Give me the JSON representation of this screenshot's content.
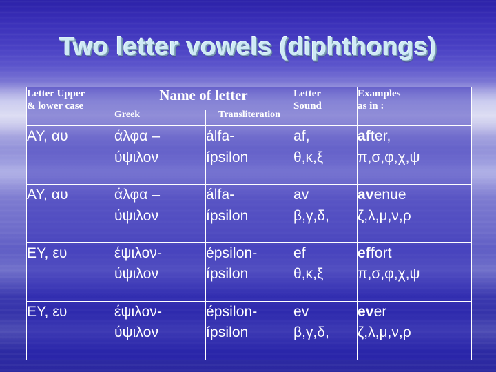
{
  "slide": {
    "title": "Two letter vowels (diphthongs)",
    "title_color": "#cfeaf5",
    "background_color": "#2b21a8",
    "border_color": "#ffffff"
  },
  "table": {
    "headers": {
      "col1_line1": "Letter Upper",
      "col1_line2": "& lower case",
      "name_of_letter": "Name of letter",
      "greek": "Greek",
      "transliteration": "Transliteration",
      "col4_line1": "Letter",
      "col4_line2": "Sound",
      "col5_line1": "Examples",
      "col5_line2": "as in :"
    },
    "rows": [
      {
        "letter_line1": "ΑΥ, αυ",
        "letter_line2": "",
        "greek_line1": "άλφα –",
        "greek_line2": "ύψιλον",
        "translit_line1": "álfa-",
        "translit_line2": "ípsilon",
        "sound_line1": "af,",
        "sound_line2": "θ,κ,ξ",
        "example_bold": "af",
        "example_rest": "ter,",
        "example_line2": "π,σ,φ,χ,ψ"
      },
      {
        "letter_line1": "ΑΥ, αυ",
        "letter_line2": "",
        "greek_line1": "άλφα –",
        "greek_line2": "ύψιλον",
        "translit_line1": "álfa-",
        "translit_line2": "ípsilon",
        "sound_line1": "av",
        "sound_line2": "β,γ,δ,",
        "example_bold": "av",
        "example_rest": "enue",
        "example_line2": "ζ,λ,μ,ν,ρ"
      },
      {
        "letter_line1": "ΕΥ, ευ",
        "letter_line2": "",
        "greek_line1": "έψιλον-",
        "greek_line2": "ύψιλον",
        "translit_line1": "épsilon-",
        "translit_line2": "ípsilon",
        "sound_line1": "ef",
        "sound_line2": "θ,κ,ξ",
        "example_bold": "ef",
        "example_rest": "fort",
        "example_line2": "π,σ,φ,χ,ψ"
      },
      {
        "letter_line1": "ΕΥ, ευ",
        "letter_line2": "",
        "greek_line1": "έψιλον-",
        "greek_line2": "ύψιλον",
        "translit_line1": "épsilon-",
        "translit_line2": "ípsilon",
        "sound_line1": "ev",
        "sound_line2": "β,γ,δ,",
        "example_bold": "ev",
        "example_rest": "er",
        "example_line2": "ζ,λ,μ,ν,ρ"
      }
    ]
  }
}
